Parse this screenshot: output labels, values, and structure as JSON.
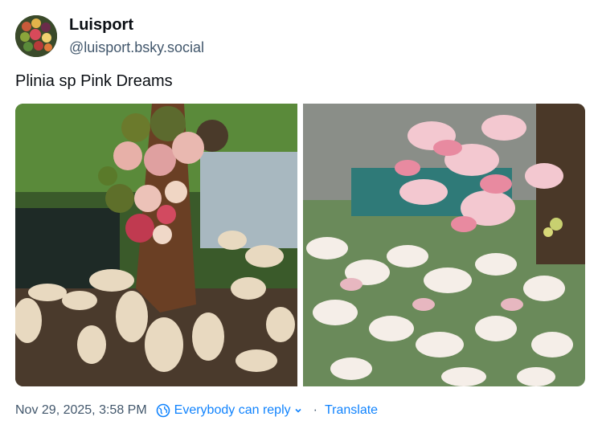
{
  "author": {
    "display_name": "Luisport",
    "handle": "@luisport.bsky.social",
    "avatar_icon": "fruit-basket-avatar"
  },
  "post": {
    "text": "Plinia sp Pink Dreams",
    "images": [
      {
        "subject": "jaboticaba fruits on trunk with cream leaves"
      },
      {
        "subject": "pink and white variegated foliage"
      }
    ]
  },
  "meta": {
    "timestamp": "Nov 29, 2025, 3:58 PM",
    "reply_setting": "Everybody can reply",
    "separator": "·",
    "translate_label": "Translate"
  },
  "colors": {
    "link": "#1083fe",
    "muted": "#42576c",
    "text": "#0b0f14"
  }
}
